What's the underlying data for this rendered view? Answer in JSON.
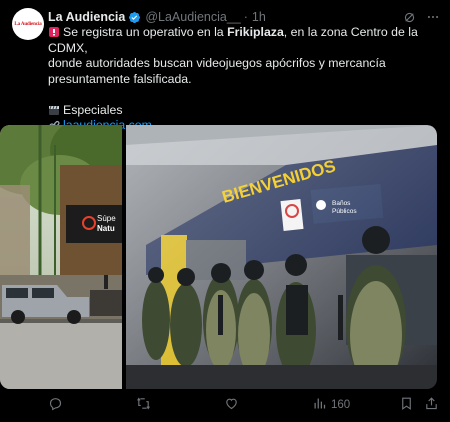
{
  "author": {
    "name": "La Audiencia",
    "handle": "@LaAudiencia__",
    "separator": "·",
    "time": "1h",
    "avatar_text": "La Audiencia"
  },
  "post": {
    "line1_pre": "Se registra un operativo en la ",
    "line1_bold": "Frikiplaza",
    "line1_post": ", en la zona Centro de la CDMX,",
    "line2": "donde autoridades buscan videojuegos apócrifos y mercancía",
    "line3": "presuntamente falsificada.",
    "section_label": "Especiales",
    "link_text": "laaudiencia.com"
  },
  "media": {
    "left_sign": "Súpe Natu",
    "right_banner": "BIENVENIDOS",
    "right_sign": "Baños Públicos"
  },
  "actions": {
    "views": "160"
  },
  "icons": [
    "verified-badge-icon",
    "grok-icon",
    "more-icon",
    "siren-emoji-icon",
    "clapper-emoji-icon",
    "link-emoji-icon",
    "reply-icon",
    "repost-icon",
    "like-icon",
    "views-icon",
    "bookmark-icon",
    "share-icon"
  ],
  "colors": {
    "background": "#000000",
    "text": "#e7e9ea",
    "muted": "#71767b",
    "link": "#1d9bf0",
    "verified": "#1d9bf0"
  }
}
